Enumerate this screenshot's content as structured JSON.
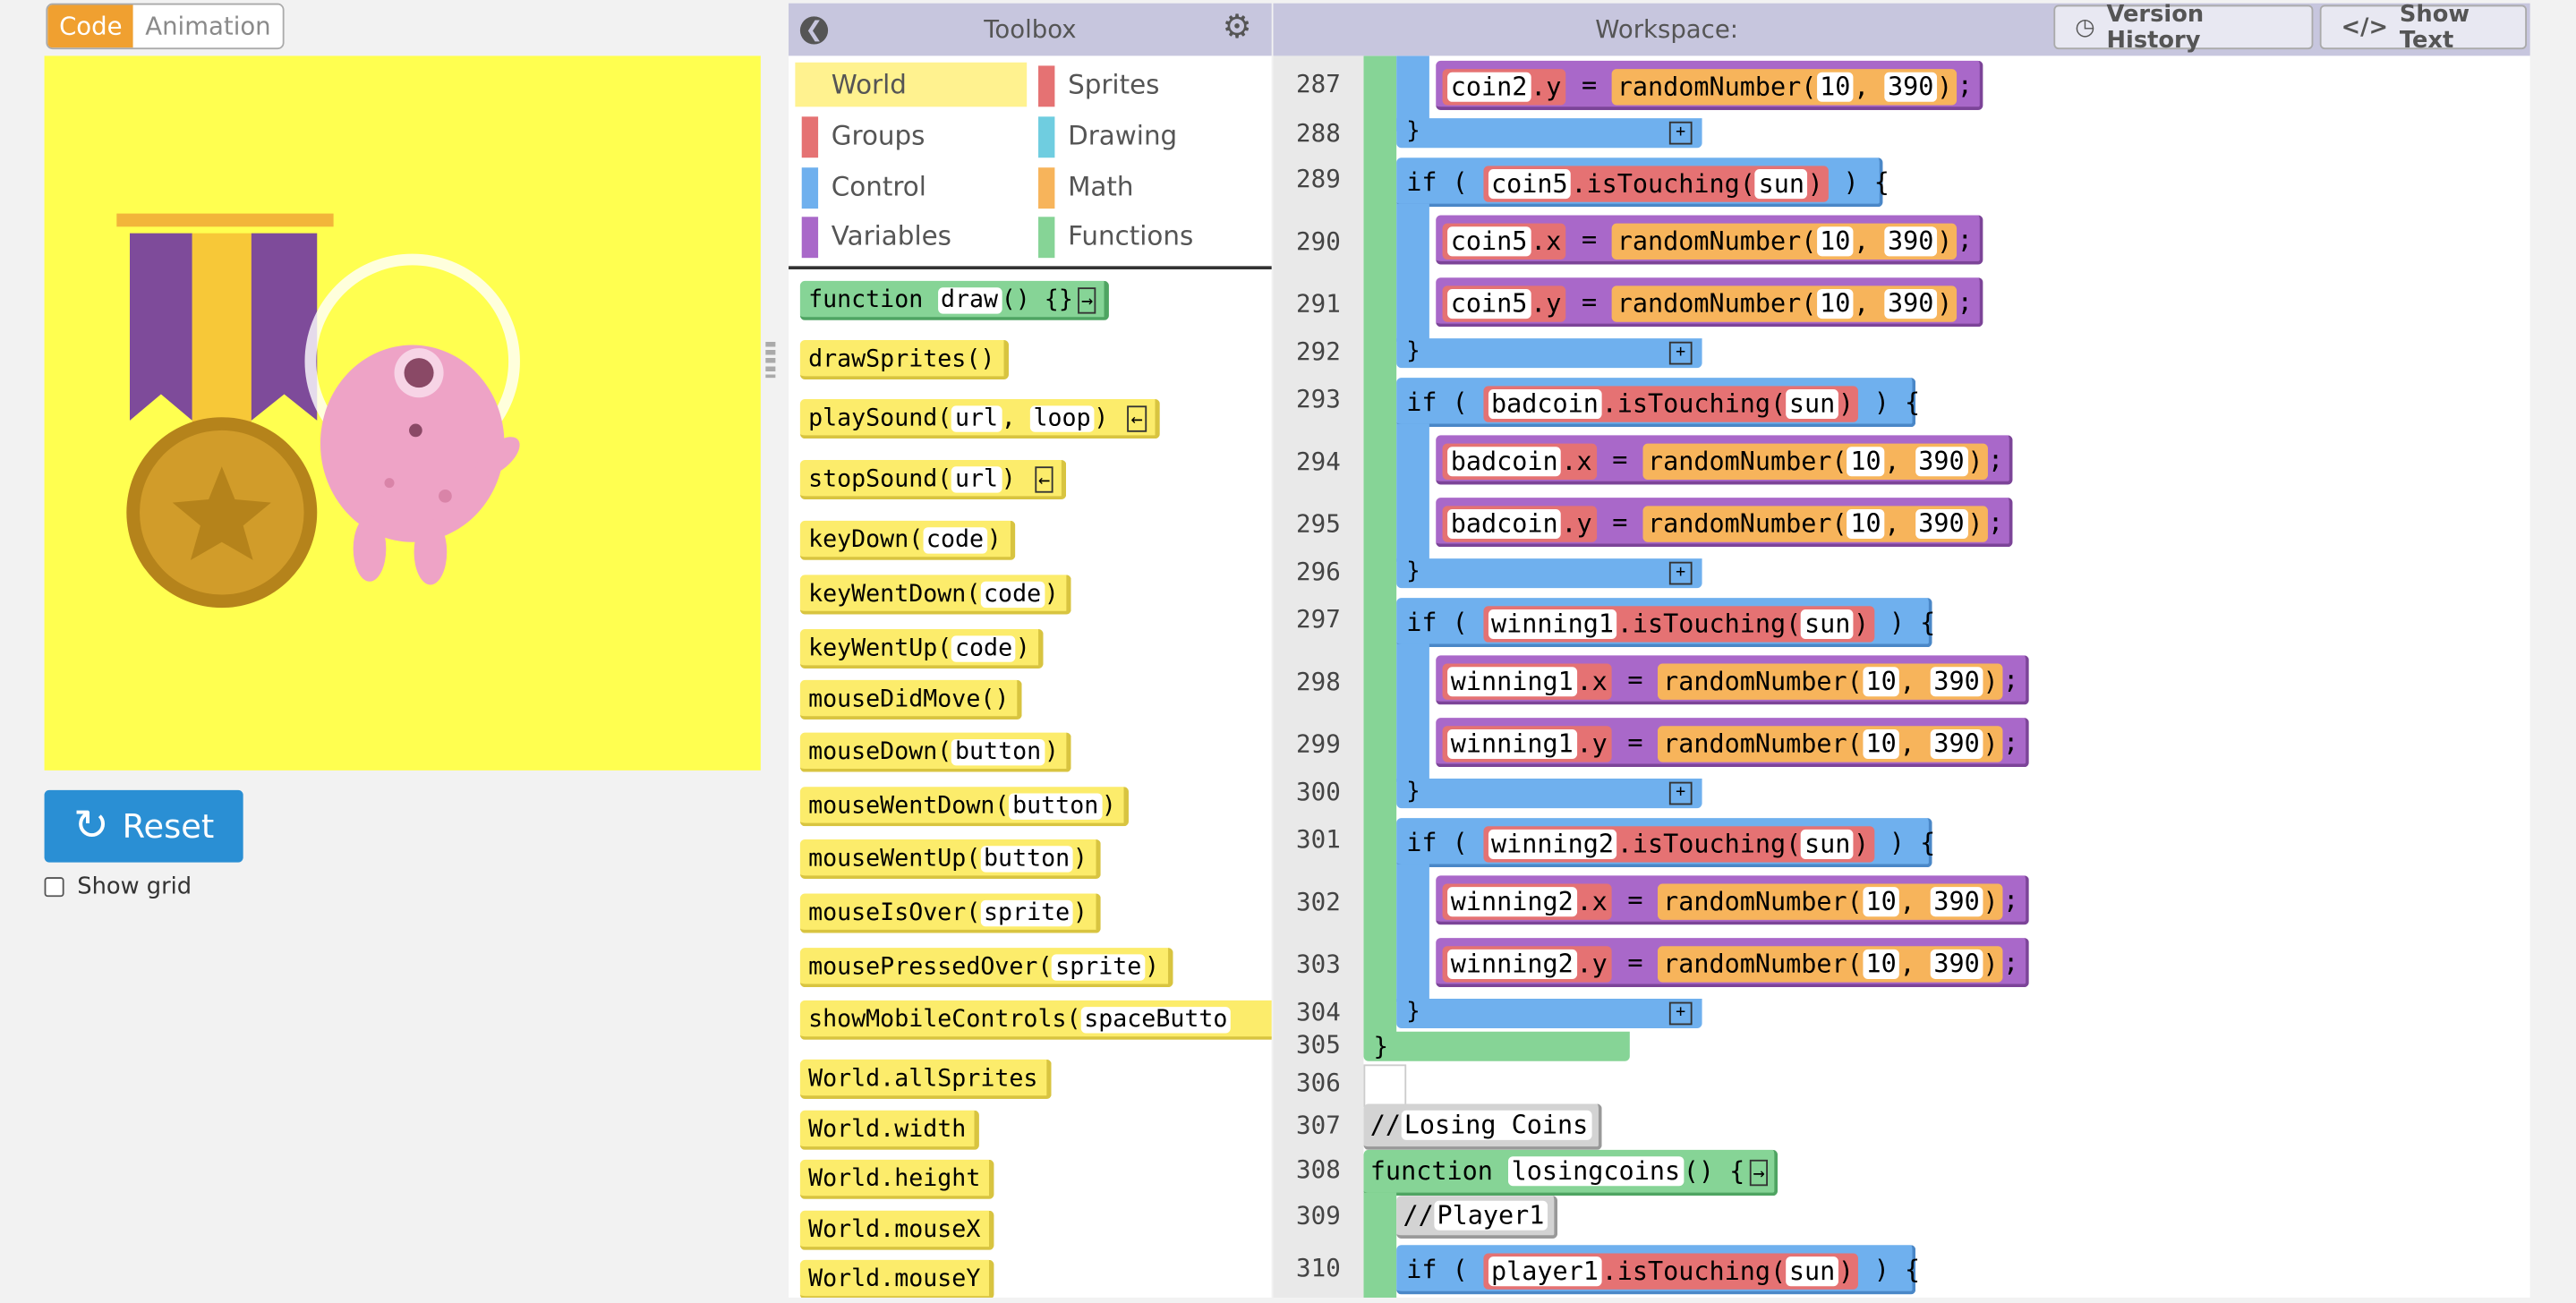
{
  "view_toggle": {
    "code": "Code",
    "animation": "Animation"
  },
  "stage": {
    "reset_label": "Reset",
    "show_grid_label": "Show grid"
  },
  "toolbox": {
    "title": "Toolbox",
    "categories": [
      {
        "label": "World",
        "color": "#fcec6b"
      },
      {
        "label": "Sprites",
        "color": "#e57273"
      },
      {
        "label": "Groups",
        "color": "#e57273"
      },
      {
        "label": "Drawing",
        "color": "#6fcde0"
      },
      {
        "label": "Control",
        "color": "#6fb0ee"
      },
      {
        "label": "Math",
        "color": "#f7b45b"
      },
      {
        "label": "Variables",
        "color": "#a968c9"
      },
      {
        "label": "Functions",
        "color": "#86d496"
      }
    ],
    "blocks": {
      "fn_draw": {
        "kw": "function",
        "name": "draw",
        "tail": "() {}"
      },
      "drawSprites": {
        "name": "drawSprites",
        "args": "()"
      },
      "playSound": {
        "name": "playSound",
        "a1": "url",
        "a2": "loop"
      },
      "stopSound": {
        "name": "stopSound",
        "a1": "url"
      },
      "keyDown": {
        "name": "keyDown",
        "a1": "code"
      },
      "keyWentDown": {
        "name": "keyWentDown",
        "a1": "code"
      },
      "keyWentUp": {
        "name": "keyWentUp",
        "a1": "code"
      },
      "mouseDidMove": {
        "name": "mouseDidMove",
        "args": "()"
      },
      "mouseDown": {
        "name": "mouseDown",
        "a1": "button"
      },
      "mouseWentDown": {
        "name": "mouseWentDown",
        "a1": "button"
      },
      "mouseWentUp": {
        "name": "mouseWentUp",
        "a1": "button"
      },
      "mouseIsOver": {
        "name": "mouseIsOver",
        "a1": "sprite"
      },
      "mousePressedOver": {
        "name": "mousePressedOver",
        "a1": "sprite"
      },
      "showMobileControls": {
        "name": "showMobileControls",
        "a1": "spaceButto"
      },
      "allSprites": "World.allSprites",
      "width": "World.width",
      "height": "World.height",
      "mouseX": "World.mouseX",
      "mouseY": "World.mouseY"
    }
  },
  "workspace": {
    "title": "Workspace:",
    "version_history": "Version History",
    "show_text": "Show Text",
    "line_numbers": [
      "287",
      "288",
      "289",
      "290",
      "291",
      "292",
      "293",
      "294",
      "295",
      "296",
      "297",
      "298",
      "299",
      "300",
      "301",
      "302",
      "303",
      "304",
      "305",
      "306",
      "307",
      "308",
      "309",
      "310"
    ],
    "code": {
      "if_kw": "if",
      "isTouching": ".isTouching",
      "sun": "sun",
      "randomNumber": "randomNumber",
      "n10": "10",
      "n390": "390",
      "dot_x": ".x",
      "dot_y": ".y",
      "coin2": "coin2",
      "coin5": "coin5",
      "badcoin": "badcoin",
      "winning1": "winning1",
      "winning2": "winning2",
      "player1": "player1",
      "comment1": "Losing Coins",
      "comment2": "Player1",
      "fn_kw": "function",
      "fn_name": "losingcoins",
      "fn_tail": "() {"
    }
  }
}
